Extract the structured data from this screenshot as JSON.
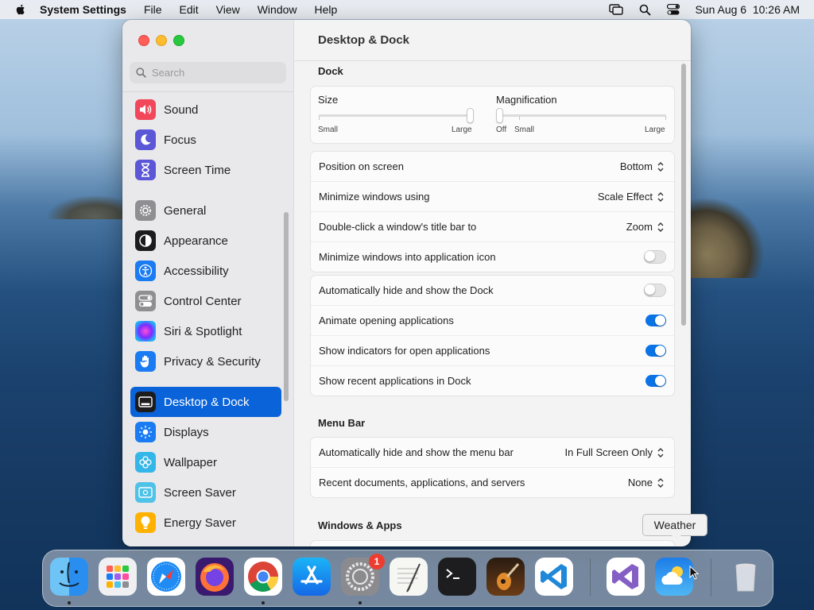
{
  "menubar": {
    "app": "System Settings",
    "items": [
      "File",
      "Edit",
      "View",
      "Window",
      "Help"
    ],
    "datetime": "Sun Aug 6  10:26 AM"
  },
  "sidebar": {
    "search_placeholder": "Search",
    "group1": [
      "Sound",
      "Focus",
      "Screen Time"
    ],
    "group2": [
      "General",
      "Appearance",
      "Accessibility",
      "Control Center",
      "Siri & Spotlight",
      "Privacy & Security"
    ],
    "group3": [
      "Desktop & Dock",
      "Displays",
      "Wallpaper",
      "Screen Saver",
      "Energy Saver"
    ],
    "active": "Desktop & Dock"
  },
  "content": {
    "title": "Desktop & Dock",
    "dock_section": "Dock",
    "size": {
      "label": "Size",
      "min_label": "Small",
      "max_label": "Large",
      "value": 0.98
    },
    "magnification": {
      "label": "Magnification",
      "off_label": "Off",
      "min_label": "Small",
      "max_label": "Large",
      "value": 0.0
    },
    "dock_rows": [
      {
        "label": "Position on screen",
        "value": "Bottom"
      },
      {
        "label": "Minimize windows using",
        "value": "Scale Effect"
      },
      {
        "label": "Double-click a window's title bar to",
        "value": "Zoom"
      },
      {
        "label": "Minimize windows into application icon",
        "toggle": false
      }
    ],
    "dock_toggles": [
      {
        "label": "Automatically hide and show the Dock",
        "toggle": false
      },
      {
        "label": "Animate opening applications",
        "toggle": true
      },
      {
        "label": "Show indicators for open applications",
        "toggle": true
      },
      {
        "label": "Show recent applications in Dock",
        "toggle": true
      }
    ],
    "menubar_section": "Menu Bar",
    "menubar_rows": [
      {
        "label": "Automatically hide and show the menu bar",
        "value": "In Full Screen Only"
      },
      {
        "label": "Recent documents, applications, and servers",
        "value": "None"
      }
    ],
    "windows_section": "Windows & Apps"
  },
  "dock": {
    "apps": [
      "Finder",
      "Launchpad",
      "Safari",
      "Firefox",
      "Chrome",
      "App Store",
      "System Settings",
      "TextEdit",
      "Terminal",
      "GarageBand",
      "VS Code",
      "Visual Studio",
      "Weather",
      "Trash"
    ],
    "badge": "1",
    "tooltip": "Weather"
  },
  "colors": {
    "accent": "#0a63d9",
    "toggle_on": "#0a74e6"
  }
}
